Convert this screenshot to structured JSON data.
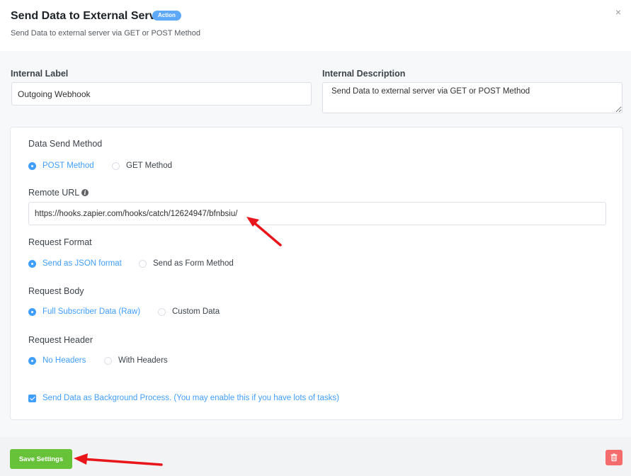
{
  "header": {
    "title": "Send Data to External Server",
    "badge": "Action",
    "subtitle": "Send Data to external server via GET or POST Method",
    "close": "×"
  },
  "fields": {
    "internal_label": {
      "label": "Internal Label",
      "value": "Outgoing Webhook"
    },
    "internal_description": {
      "label": "Internal Description",
      "value": "Send Data to external server via GET or POST Method"
    }
  },
  "settings": {
    "send_method": {
      "label": "Data Send Method",
      "options": [
        {
          "label": "POST Method",
          "selected": true
        },
        {
          "label": "GET Method",
          "selected": false
        }
      ]
    },
    "remote_url": {
      "label": "Remote URL",
      "info_glyph": "i",
      "value": "https://hooks.zapier.com/hooks/catch/12624947/bfnbsiu/"
    },
    "request_format": {
      "label": "Request Format",
      "options": [
        {
          "label": "Send as JSON format",
          "selected": true
        },
        {
          "label": "Send as Form Method",
          "selected": false
        }
      ]
    },
    "request_body": {
      "label": "Request Body",
      "options": [
        {
          "label": "Full Subscriber Data (Raw)",
          "selected": true
        },
        {
          "label": "Custom Data",
          "selected": false
        }
      ]
    },
    "request_header": {
      "label": "Request Header",
      "options": [
        {
          "label": "No Headers",
          "selected": true
        },
        {
          "label": "With Headers",
          "selected": false
        }
      ]
    },
    "background_process": {
      "label": "Send Data as Background Process. (You may enable this if you have lots of tasks)",
      "checked": true
    }
  },
  "footer": {
    "save_label": "Save Settings"
  },
  "icons": {
    "close": "close-icon",
    "info": "info-icon",
    "delete": "trash-icon",
    "annotation": "red-arrow-icon"
  },
  "colors": {
    "accent": "#409eff",
    "badge": "#5ea9f7",
    "save": "#67c23a",
    "danger": "#f56c6c",
    "annotation": "#e8161b"
  }
}
